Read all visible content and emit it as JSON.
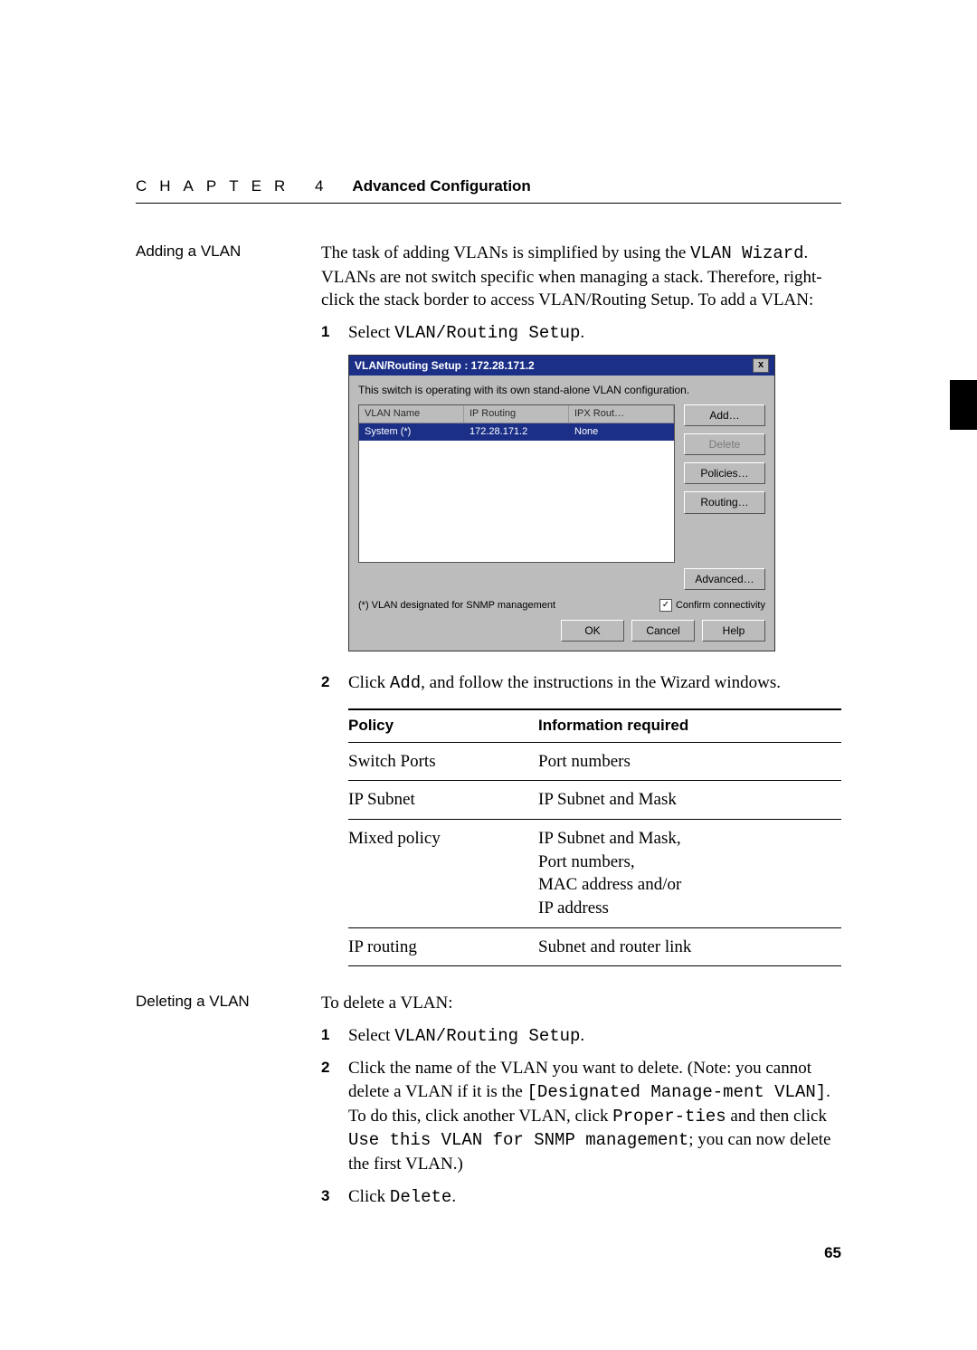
{
  "header": {
    "chapter": "CHAPTER 4",
    "title": "Advanced Configuration"
  },
  "adding": {
    "side_label": "Adding a VLAN",
    "intro_pre": "The task of adding VLANs is simplified by using the ",
    "intro_code": "VLAN Wizard",
    "intro_post": ". VLANs are not switch specific when managing a stack. Therefore, right-click the stack border to access VLAN/Routing Setup. To add a VLAN:",
    "step1_num": "1",
    "step1_pre": "Select ",
    "step1_code": "VLAN/Routing Setup",
    "step1_post": ".",
    "step2_num": "2",
    "step2_pre": "Click ",
    "step2_code": "Add",
    "step2_post": ", and follow the instructions in the Wizard windows."
  },
  "dialog": {
    "title": "VLAN/Routing Setup : 172.28.171.2",
    "close": "x",
    "desc": "This switch is operating with its own stand-alone VLAN configuration.",
    "col1": "VLAN Name",
    "col2": "IP Routing",
    "col3": "IPX Rout…",
    "row_name": "System (*)",
    "row_ip": "172.28.171.2",
    "row_ipx": "None",
    "btn_add": "Add…",
    "btn_delete": "Delete",
    "btn_policies": "Policies…",
    "btn_routing": "Routing…",
    "btn_advanced": "Advanced…",
    "note": "(*) VLAN designated for SNMP management",
    "check_label": "Confirm connectivity",
    "btn_ok": "OK",
    "btn_cancel": "Cancel",
    "btn_help": "Help"
  },
  "policy_table": {
    "h1": "Policy",
    "h2": "Information required",
    "rows": [
      {
        "policy": "Switch Ports",
        "info": "Port numbers"
      },
      {
        "policy": "IP Subnet",
        "info": "IP Subnet and Mask"
      },
      {
        "policy": "Mixed policy",
        "info": "IP Subnet and Mask,\nPort numbers,\nMAC address and/or\nIP address"
      },
      {
        "policy": "IP routing",
        "info": "Subnet and router link"
      }
    ]
  },
  "deleting": {
    "side_label": "Deleting a VLAN",
    "intro": "To delete a VLAN:",
    "step1_num": "1",
    "step1_pre": "Select ",
    "step1_code": "VLAN/Routing Setup",
    "step1_post": ".",
    "step2_num": "2",
    "step2_a": "Click the name of the VLAN you want to delete. (Note: you cannot delete a VLAN if it is the ",
    "step2_code1": "[Designated Manage-ment VLAN]",
    "step2_b": ". To do this, click another VLAN, click ",
    "step2_code2": "Proper-ties",
    "step2_c": " and then click ",
    "step2_code3": "Use this VLAN for SNMP management",
    "step2_d": "; you can now delete the first VLAN.)",
    "step3_num": "3",
    "step3_pre": "Click ",
    "step3_code": "Delete",
    "step3_post": "."
  },
  "page_number": "65"
}
